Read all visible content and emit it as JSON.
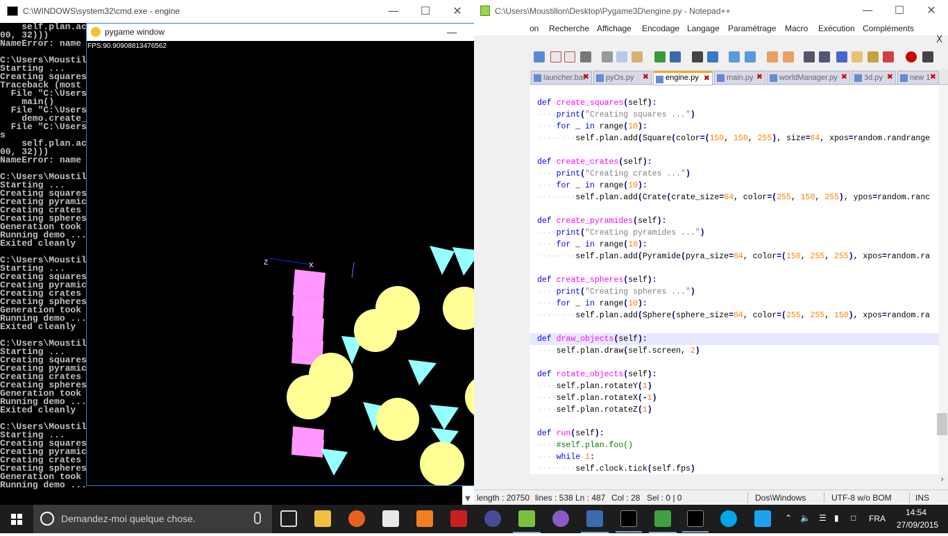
{
  "cmd": {
    "title": "C:\\WINDOWS\\system32\\cmd.exe - engine",
    "lines": [
      "    self.plan.ac",
      "00, 32)))",
      "NameError: name",
      "",
      "C:\\Users\\Moustil",
      "Starting ...",
      "Creating squares",
      "Traceback (most",
      "  File \"C:\\Users",
      "    main()",
      "  File \"C:\\Users",
      "    demo.create_",
      "  File \"C:\\Users",
      "s",
      "    self.plan.ac",
      "00, 32)))",
      "NameError: name",
      "",
      "C:\\Users\\Moustil",
      "Starting ...",
      "Creating squares",
      "Creating pyramic",
      "Creating crates",
      "Creating spheres",
      "Generation took",
      "Running demo ...",
      "Exited cleanly",
      "",
      "C:\\Users\\Moustil",
      "Starting ...",
      "Creating squares",
      "Creating pyramic",
      "Creating crates",
      "Creating spheres",
      "Generation took",
      "Running demo ...",
      "Exited cleanly",
      "",
      "C:\\Users\\Moustil",
      "Starting ...",
      "Creating squares",
      "Creating pyramic",
      "Creating crates",
      "Creating spheres",
      "Generation took",
      "Running demo ...",
      "Exited cleanly",
      "",
      "C:\\Users\\Moustil",
      "Starting ...",
      "Creating squares",
      "Creating pyramic",
      "Creating crates",
      "Creating spheres",
      "Generation took",
      "Running demo ..."
    ]
  },
  "pygame": {
    "title": "pygame window",
    "fps": "FPS:90.90908813476562",
    "axis_z": "Z",
    "axis_x": "X",
    "colors": {
      "square": "#ff96ff",
      "sphere": "#ffff96",
      "pyramid": "#96ffff"
    }
  },
  "npp": {
    "title": "C:\\Users\\Moustillon\\Desktop\\Pygame3D\\engine.py - Notepad++",
    "menu": [
      "on",
      "Recherche",
      "Affichage",
      "Encodage",
      "Langage",
      "Paramétrage",
      "Macro",
      "Exécution",
      "Compléments"
    ],
    "close_x": "X",
    "tabs": [
      "launcher.bat",
      "pyOs.py",
      "engine.py",
      "main.py",
      "worldManager.py",
      "3d.py",
      "new 1"
    ],
    "active_tab": "engine.py",
    "status": {
      "length": "length : 20750",
      "lines": "lines : 538",
      "ln": "Ln : 487",
      "col": "Col : 28",
      "sel": "Sel : 0 | 0",
      "eol": "Dos\\Windows",
      "encoding": "UTF-8 w/o BOM",
      "mode": "INS"
    }
  },
  "taskbar": {
    "search_placeholder": "Demandez-moi quelque chose.",
    "language": "FRA",
    "time": "14:54",
    "date": "27/09/2015"
  }
}
